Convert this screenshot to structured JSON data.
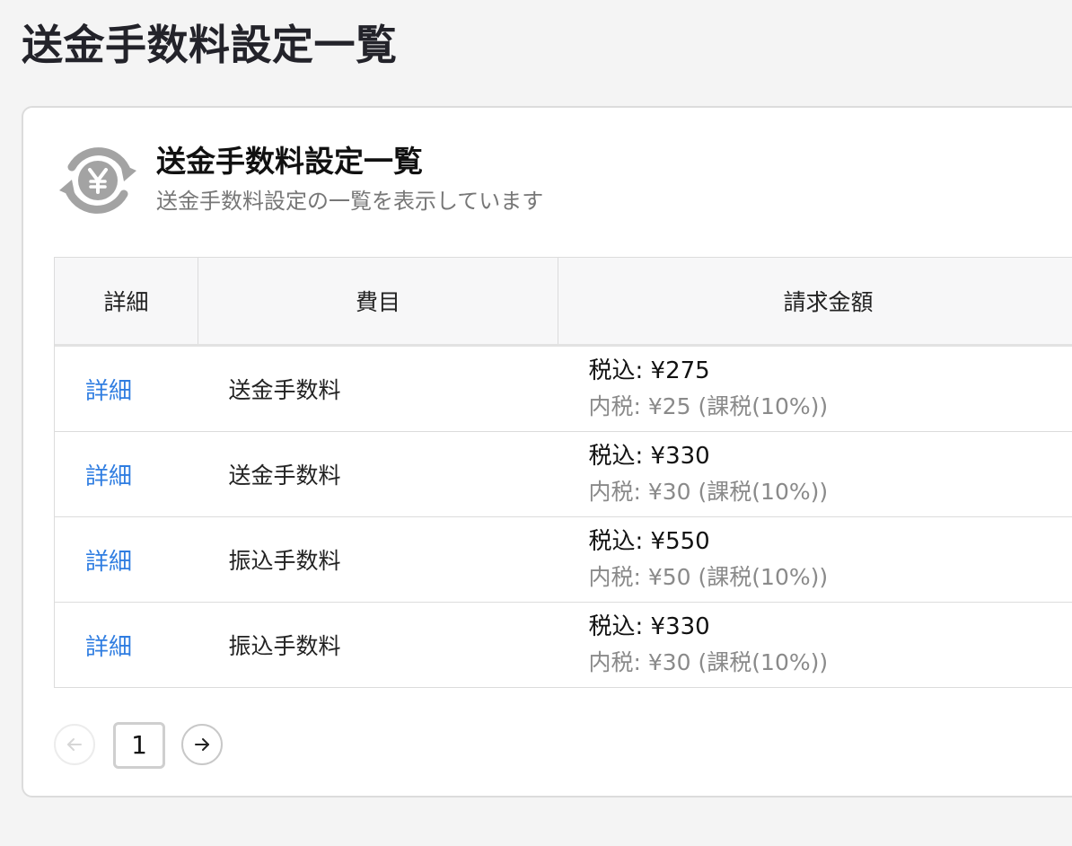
{
  "page": {
    "title": "送金手数料設定一覧"
  },
  "card": {
    "icon": "yen-exchange-icon",
    "title": "送金手数料設定一覧",
    "subtitle": "送金手数料設定の一覧を表示しています"
  },
  "table": {
    "headers": {
      "detail": "詳細",
      "item": "費目",
      "amount": "請求金額"
    },
    "rows": [
      {
        "detail": "詳細",
        "item": "送金手数料",
        "amount_main": "税込: ¥275",
        "amount_sub": "内税: ¥25 (課税(10%))"
      },
      {
        "detail": "詳細",
        "item": "送金手数料",
        "amount_main": "税込: ¥330",
        "amount_sub": "内税: ¥30 (課税(10%))"
      },
      {
        "detail": "詳細",
        "item": "振込手数料",
        "amount_main": "税込: ¥550",
        "amount_sub": "内税: ¥50 (課税(10%))"
      },
      {
        "detail": "詳細",
        "item": "振込手数料",
        "amount_main": "税込: ¥330",
        "amount_sub": "内税: ¥30 (課税(10%))"
      }
    ]
  },
  "pagination": {
    "current_page": "1",
    "prev_icon": "arrow-left-icon",
    "next_icon": "arrow-right-icon"
  },
  "colors": {
    "link": "#2f7de1",
    "background": "#f4f4f4",
    "muted_text": "#8a8a8a"
  }
}
